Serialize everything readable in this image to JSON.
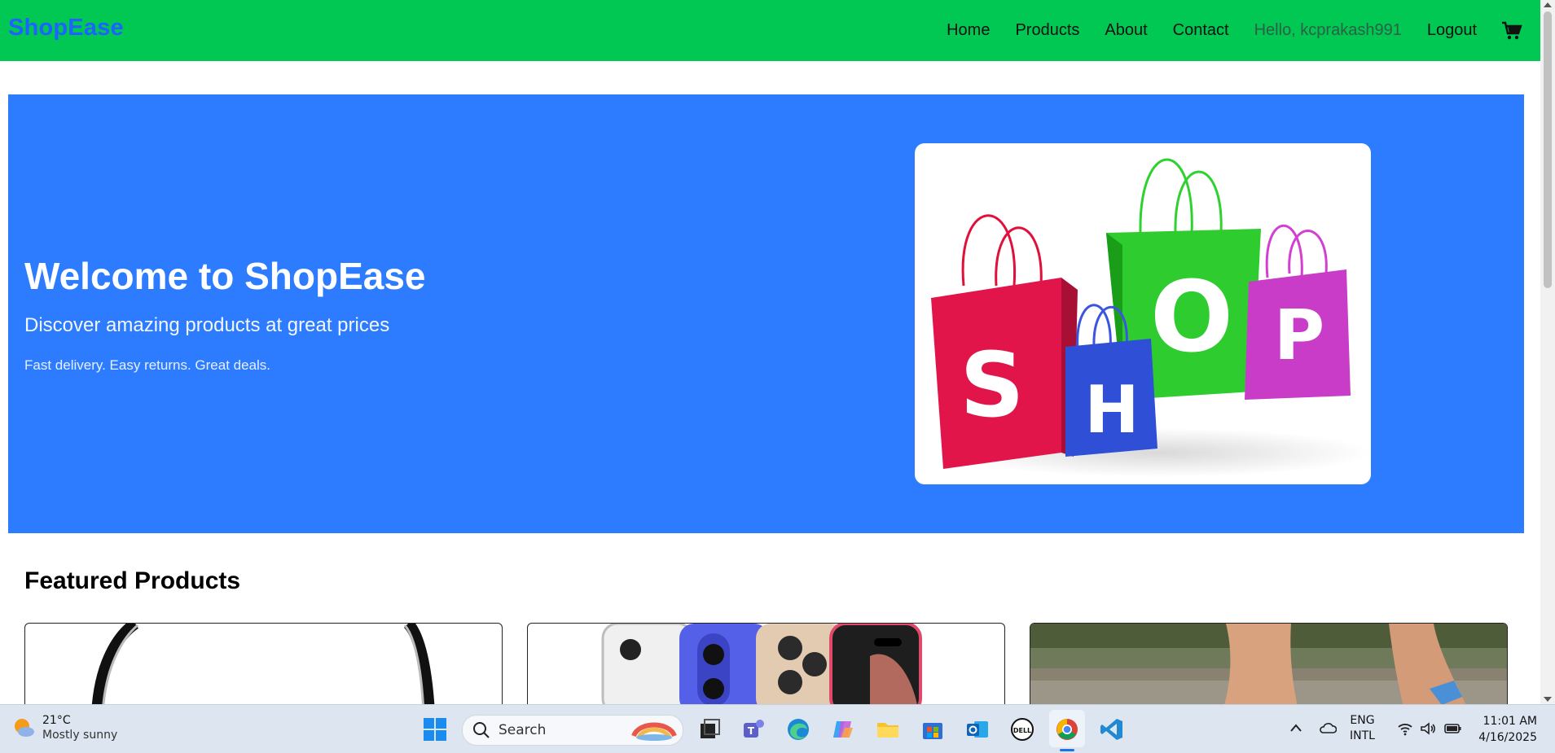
{
  "navbar": {
    "brand": "ShopEase",
    "links": [
      "Home",
      "Products",
      "About",
      "Contact"
    ],
    "greeting": "Hello, kcprakash991",
    "logout": "Logout",
    "cart_icon": "shopping-cart-icon"
  },
  "hero": {
    "title": "Welcome to ShopEase",
    "subtitle": "Discover amazing products at great prices",
    "note": "Fast delivery. Easy returns. Great deals.",
    "image_letters": [
      "S",
      "H",
      "O",
      "P"
    ]
  },
  "featured": {
    "title": "Featured Products"
  },
  "taskbar": {
    "weather_temp": "21°C",
    "weather_desc": "Mostly sunny",
    "search_placeholder": "Search",
    "lang_line1": "ENG",
    "lang_line2": "INTL",
    "time": "11:01 AM",
    "date": "4/16/2025",
    "dell_label": "DELL"
  },
  "colors": {
    "navbar_bg": "#00c853",
    "brand": "#1e63ff",
    "hero_bg": "#2d7cff"
  }
}
